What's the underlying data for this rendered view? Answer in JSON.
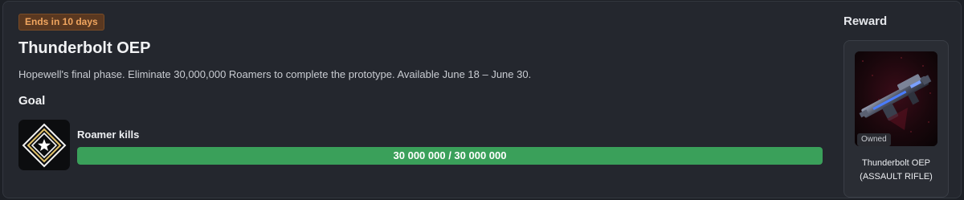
{
  "event": {
    "badge": "Ends in 10 days",
    "title": "Thunderbolt OEP",
    "description": "Hopewell's final phase. Eliminate 30,000,000 Roamers to complete the prototype. Available June 18 – June 30."
  },
  "goal": {
    "heading": "Goal",
    "icon": "star-diamond-icon",
    "label": "Roamer kills",
    "progress_text": "30 000 000 / 30 000 000",
    "progress_fraction": 1.0,
    "progress_color": "#3aa05a"
  },
  "reward": {
    "heading": "Reward",
    "status": "Owned",
    "name_line1": "Thunderbolt OEP",
    "name_line2": "(ASSAULT RIFLE)",
    "icon": "assault-rifle-image"
  },
  "colors": {
    "background": "#1d2026",
    "panel": "#24272e",
    "badge_text": "#f0a55f",
    "badge_bg": "#5a3820",
    "progress_fill": "#3aa05a"
  }
}
